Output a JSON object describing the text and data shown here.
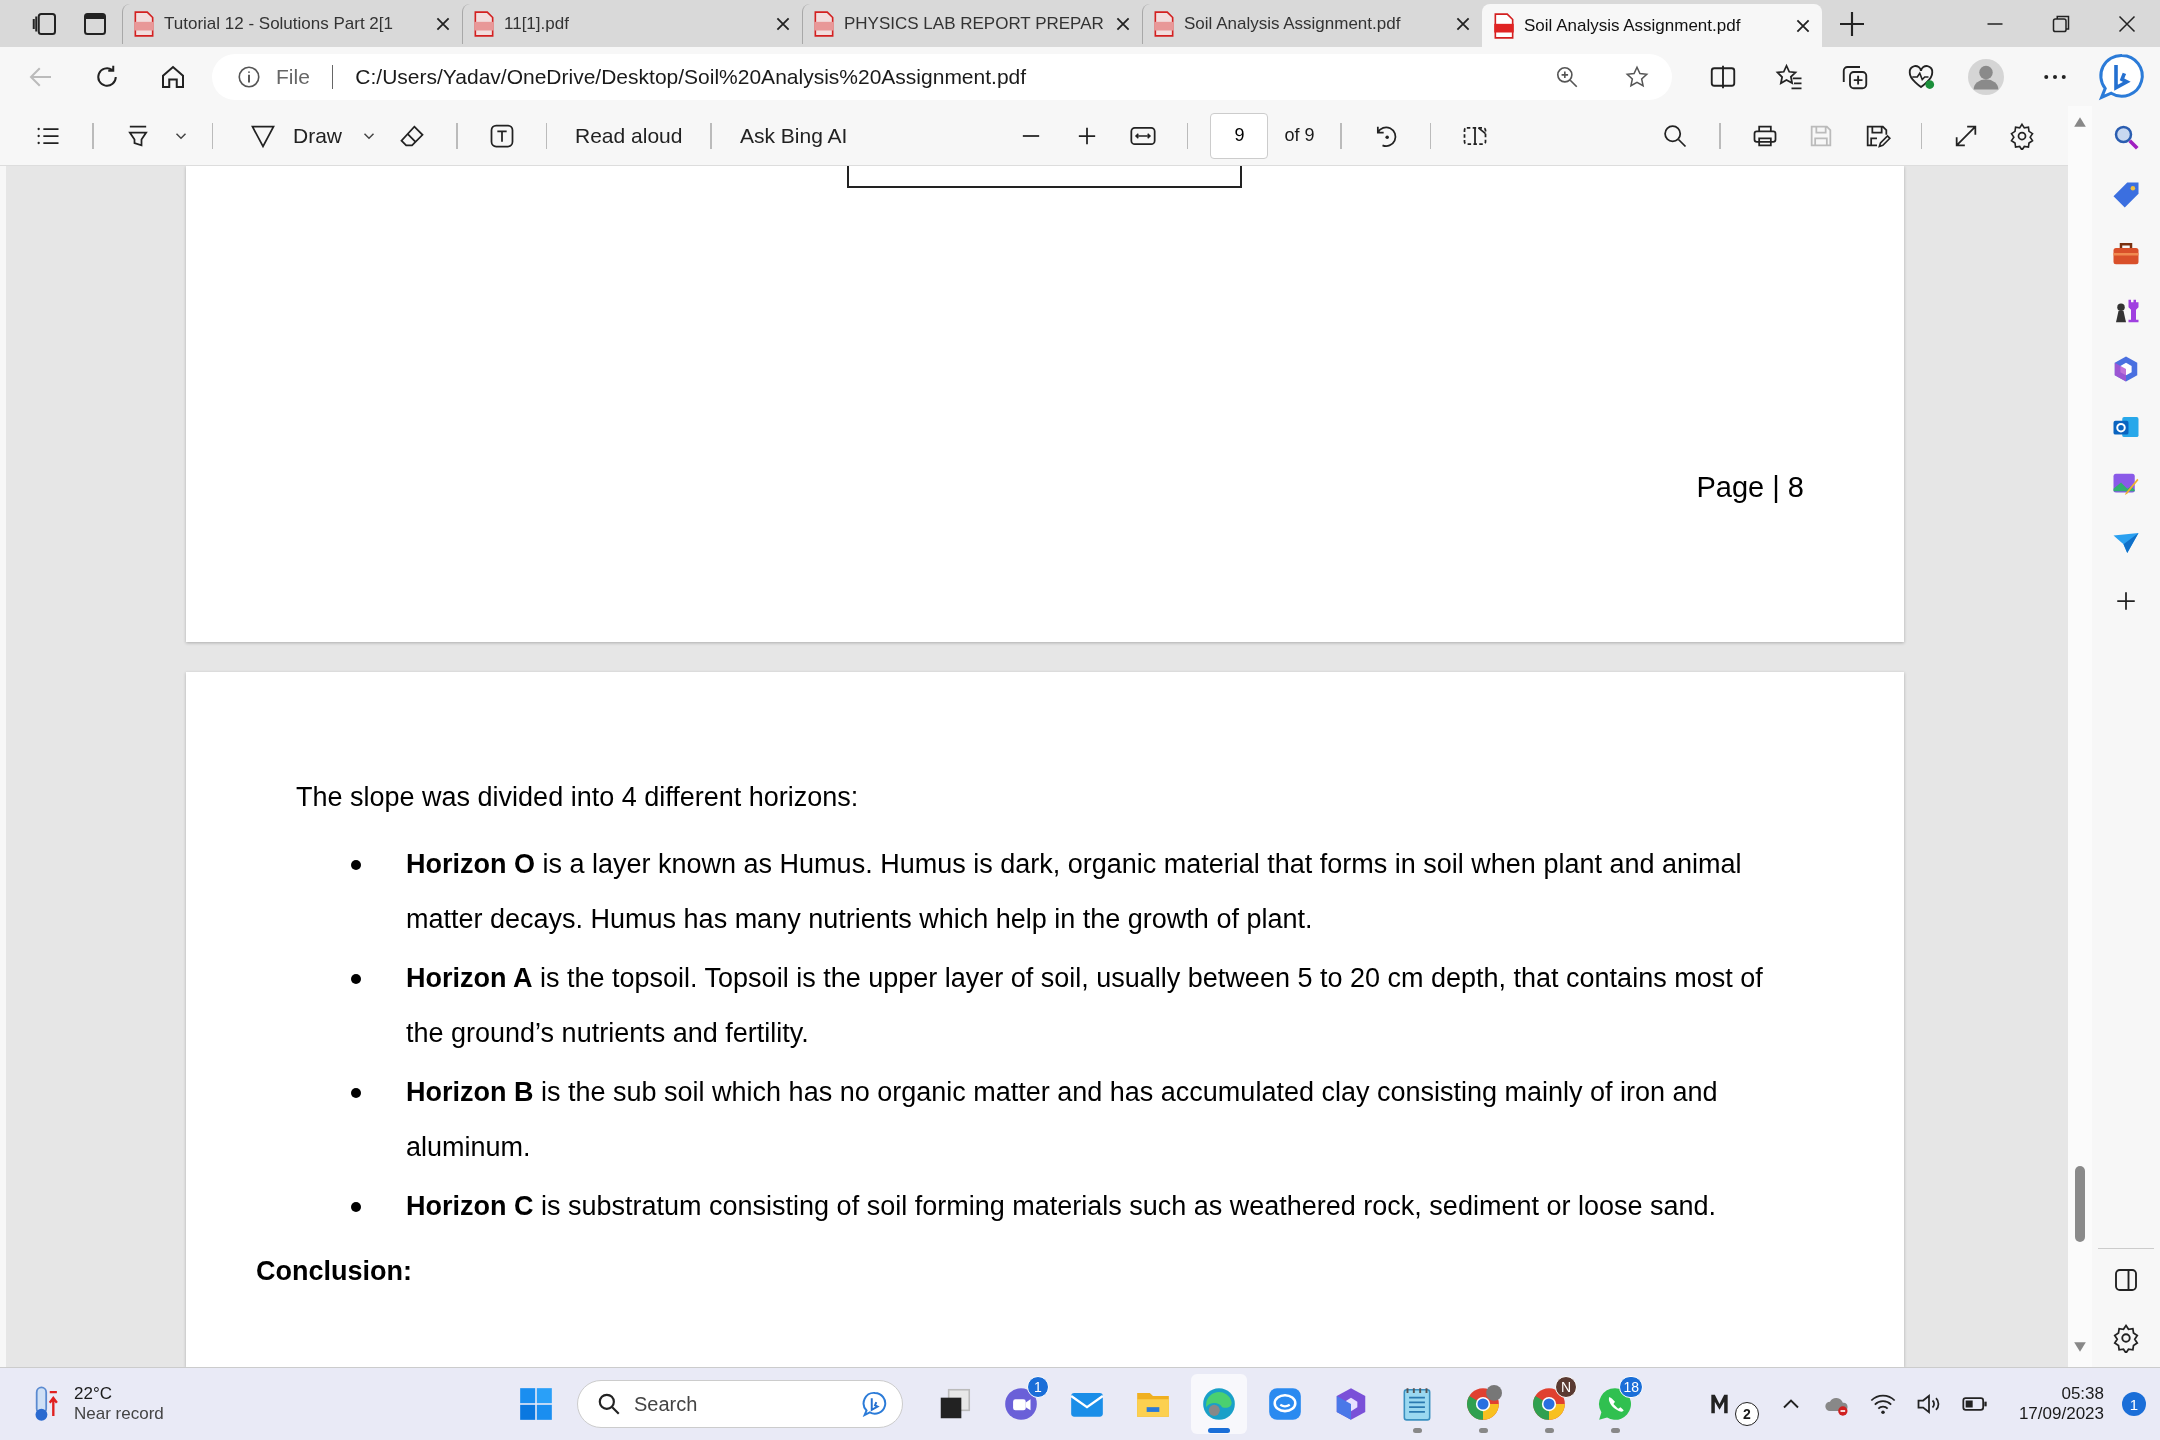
{
  "tabs": [
    {
      "title": "Tutorial 12 - Solutions Part 2[1",
      "selected": false
    },
    {
      "title": "11[1].pdf",
      "selected": false
    },
    {
      "title": "PHYSICS LAB REPORT PREPAR",
      "selected": false
    },
    {
      "title": "Soil Analysis Assignment.pdf",
      "selected": false
    },
    {
      "title": "Soil Analysis Assignment.pdf",
      "selected": true
    }
  ],
  "address_bar": {
    "scheme": "File",
    "url": "C:/Users/Yadav/OneDrive/Desktop/Soil%20Analysis%20Assignment.pdf"
  },
  "pdf_toolbar": {
    "draw": "Draw",
    "read_aloud": "Read aloud",
    "ask": "Ask Bing AI",
    "page_number": "9",
    "page_count": "of 9"
  },
  "document": {
    "page_footer": "Page | 8",
    "intro": "The slope was divided into 4 different horizons:",
    "bullets": [
      {
        "text": "**Horizon O** is a layer known as Humus. Humus is dark, organic material that forms in soil when plant and animal matter decays. Humus has many nutrients which help in the growth of plant."
      },
      {
        "text": "**Horizon A** is the topsoil. Topsoil is the upper layer of soil, usually between 5 to 20 cm depth, that contains most of the ground’s nutrients and fertility."
      },
      {
        "text": "**Horizon B** is the sub soil which has no organic matter and has accumulated clay consisting mainly of iron and aluminum."
      },
      {
        "text": "**Horizon C** is substratum consisting of soil forming materials such as weathered rock, sediment or loose sand."
      }
    ],
    "heading": "Conclusion:"
  },
  "taskbar": {
    "weather": {
      "temperature": "22°C",
      "note": "Near record"
    },
    "search": {
      "placeholder": "Search"
    },
    "apps": [
      {
        "kind": "task-view",
        "selected": false,
        "running": false
      },
      {
        "kind": "chat",
        "badge": "1",
        "selected": false,
        "running": false
      },
      {
        "kind": "mail",
        "selected": false,
        "running": false
      },
      {
        "kind": "folder",
        "selected": false,
        "running": false
      },
      {
        "kind": "edge",
        "selected": true,
        "running": true
      },
      {
        "kind": "messenger",
        "selected": false,
        "running": false
      },
      {
        "kind": "copilot",
        "selected": false,
        "running": false
      },
      {
        "kind": "notepad",
        "selected": false,
        "running": true
      },
      {
        "kind": "chrome-photo",
        "selected": false,
        "running": true
      },
      {
        "kind": "chrome",
        "badge": "N",
        "selected": false,
        "running": true
      },
      {
        "kind": "whatsapp",
        "badge": "18",
        "selected": false,
        "running": true
      }
    ],
    "tray_badge": "2",
    "clock": {
      "time": "05:38",
      "date": "17/09/2023"
    },
    "notifications": "1"
  }
}
